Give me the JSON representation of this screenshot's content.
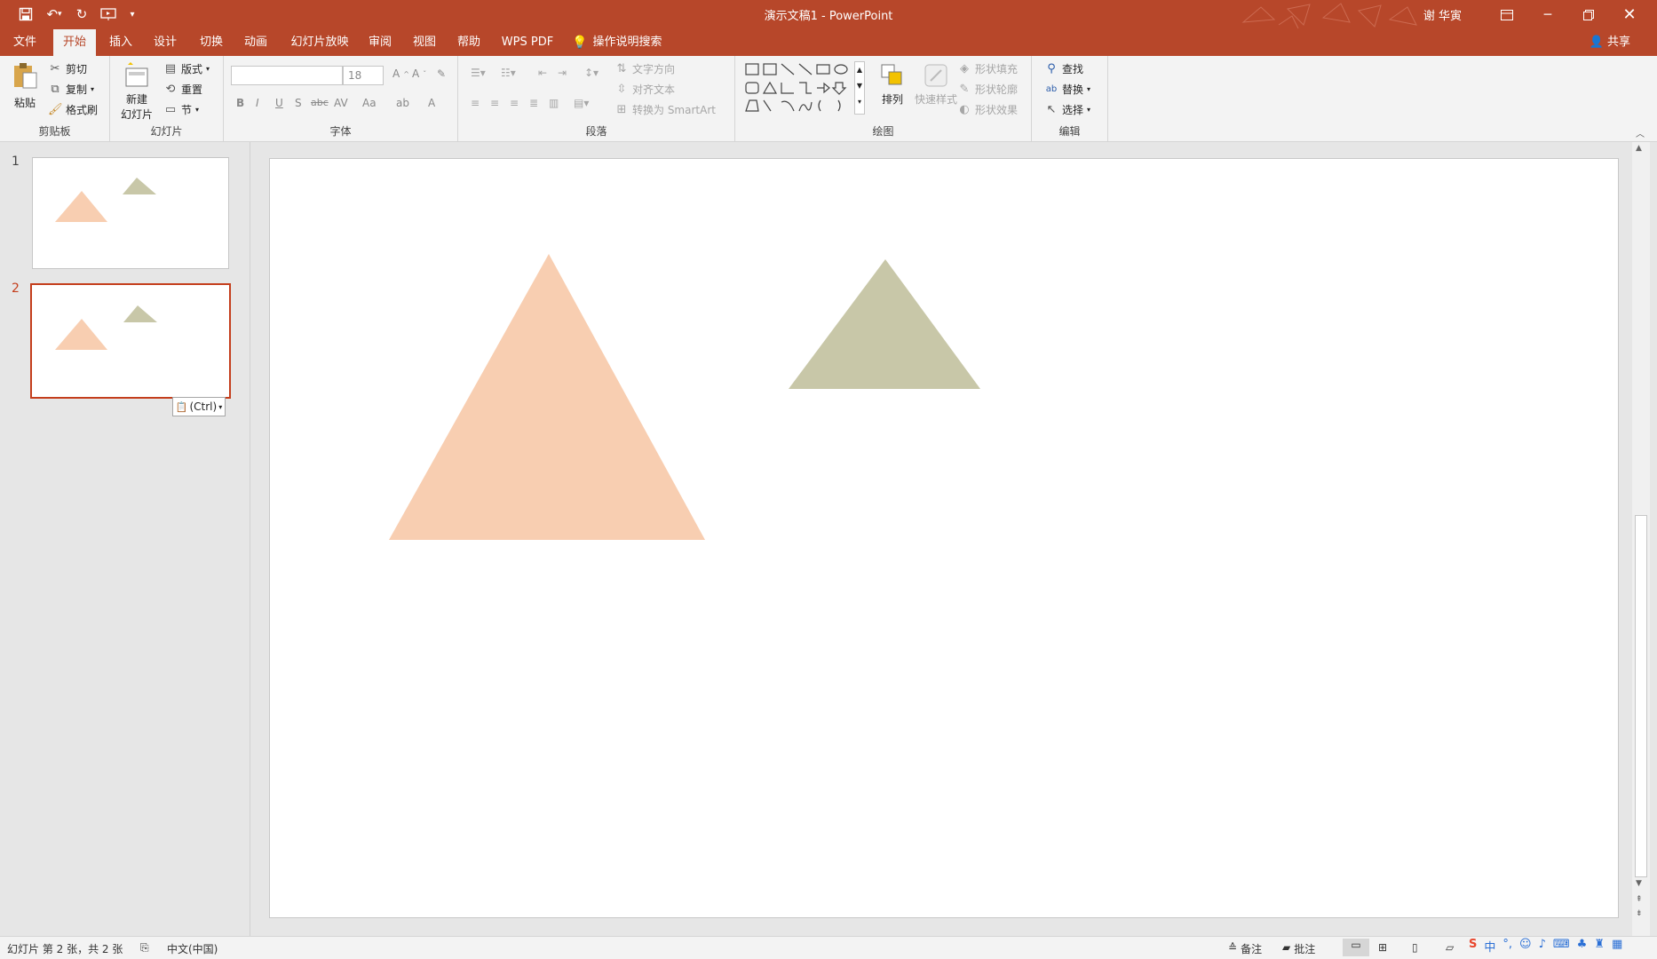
{
  "titlebar": {
    "doc_title": "演示文稿1  -  PowerPoint",
    "user": "谢 华寅",
    "quick_access": [
      "save-icon",
      "undo-icon",
      "redo-icon",
      "start-from-beginning-icon",
      "customize-icon"
    ]
  },
  "tabs": [
    "文件",
    "开始",
    "插入",
    "设计",
    "切换",
    "动画",
    "幻灯片放映",
    "审阅",
    "视图",
    "帮助",
    "WPS PDF"
  ],
  "active_tab": "开始",
  "tell_me": "操作说明搜索",
  "share": "共享",
  "ribbon": {
    "clipboard": {
      "label": "剪贴板",
      "paste": "粘贴",
      "cut": "剪切",
      "copy": "复制",
      "format_painter": "格式刷"
    },
    "slides": {
      "label": "幻灯片",
      "new_slide_1": "新建",
      "new_slide_2": "幻灯片",
      "layout": "版式",
      "reset": "重置",
      "section": "节"
    },
    "font": {
      "label": "字体",
      "font_name": "",
      "font_size": "18",
      "bold": "B",
      "italic": "I",
      "underline": "U",
      "shadow": "S",
      "strike": "abc",
      "spacing": "AV",
      "case": "Aa",
      "color": "A"
    },
    "paragraph": {
      "label": "段落",
      "text_direction": "文字方向",
      "align_text": "对齐文本",
      "smartart": "转换为 SmartArt"
    },
    "drawing": {
      "label": "绘图",
      "arrange": "排列",
      "quick_styles": "快速样式",
      "shape_fill": "形状填充",
      "shape_outline": "形状轮廓",
      "shape_effects": "形状效果"
    },
    "editing": {
      "label": "编辑",
      "find": "查找",
      "replace": "替换",
      "select": "选择"
    }
  },
  "slides": [
    {
      "number": "1"
    },
    {
      "number": "2"
    }
  ],
  "selected_slide": 2,
  "paste_options": "(Ctrl)",
  "shapes": {
    "large_triangle_color": "#f8ceb1",
    "small_triangle_color": "#c8c7a8"
  },
  "status": {
    "slide_info": "幻灯片 第 2 张，共 2 张",
    "language": "中文(中国)",
    "notes": "备注",
    "comments": "批注"
  },
  "colors": {
    "accent": "#b7472a",
    "selected_border": "#c43e1c"
  }
}
